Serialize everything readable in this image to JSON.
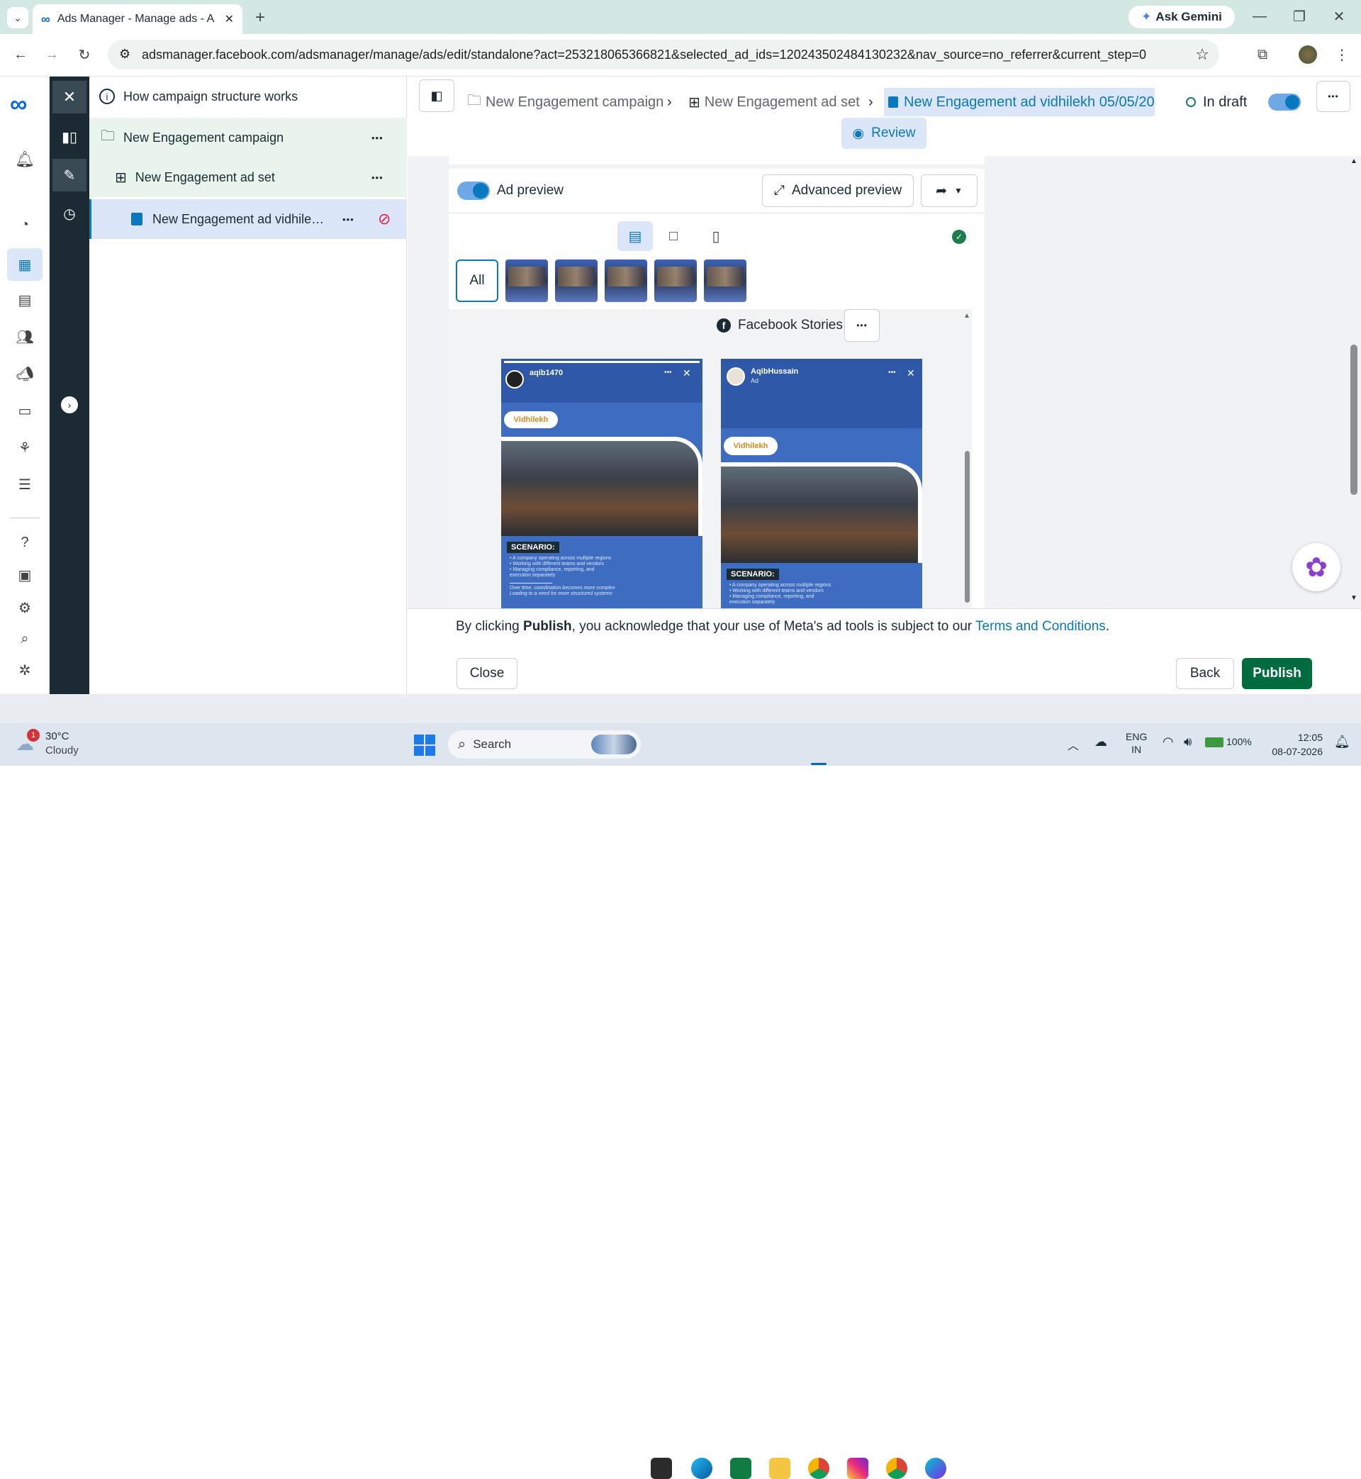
{
  "browser": {
    "tab_title": "Ads Manager - Manage ads - A",
    "new_tab": "+",
    "gemini": "Ask Gemini",
    "url": "adsmanager.facebook.com/adsmanager/manage/ads/edit/standalone?act=253218065366821&selected_ad_ids=120243502484130232&nav_source=no_referrer&current_step=0"
  },
  "tree": {
    "how_it_works": "How campaign structure works",
    "campaign": "New Engagement campaign",
    "adset": "New Engagement ad set",
    "ad": "New Engagement ad vidhile…",
    "more": "•••"
  },
  "breadcrumb": {
    "campaign": "New Engagement campaign",
    "adset": "New Engagement ad set",
    "ad": "New Engagement ad vidhilekh 05/05/20",
    "status": "In draft",
    "more": "•••"
  },
  "review_label": "Review",
  "preview": {
    "toggle_label": "Ad preview",
    "advanced": "Advanced preview",
    "all": "All",
    "placement": "Facebook Stories",
    "more": "•••",
    "stories": [
      {
        "user": "aqib1470",
        "sub": "",
        "logo": "Vidhilekh",
        "scenario": "SCENARIO:",
        "bullets": [
          "• A company operating across multiple regions",
          "• Working with different teams and vendors",
          "• Managing compliance, reporting, and",
          "  execution separately"
        ],
        "tail": "Over time, coordination becomes more complex",
        "tail2": "Leading to a need for more structured systems"
      },
      {
        "user": "AqibHussain",
        "sub": "Ad",
        "logo": "Vidhilekh",
        "scenario": "SCENARIO:",
        "bullets": [
          "• A company operating across multiple regions",
          "• Working with different teams and vendors",
          "• Managing compliance, reporting, and",
          "  execution separately"
        ],
        "tail": "",
        "tail2": ""
      }
    ]
  },
  "footer": {
    "text_pre": "By clicking ",
    "text_bold": "Publish",
    "text_mid": ", you acknowledge that your use of Meta's ad tools is subject to our ",
    "terms": "Terms and Conditions",
    "text_end": ".",
    "close": "Close",
    "back": "Back",
    "publish": "Publish"
  },
  "taskbar": {
    "weather_temp": "30°C",
    "weather_desc": "Cloudy",
    "weather_badge": "1",
    "search": "Search",
    "lang1": "ENG",
    "lang2": "IN",
    "battery": "100%",
    "time": "12:05",
    "date": "08-07-2026"
  },
  "colors": {
    "accent": "#0a78be",
    "publish": "#006b3e",
    "dark_rail": "#1c2b33"
  },
  "icons": [
    "meta-logo-icon",
    "bell-icon",
    "dashboard-icon",
    "table-icon",
    "pages-icon",
    "audience-icon",
    "campaign-icon",
    "billing-icon",
    "network-icon",
    "menu-icon",
    "help-icon",
    "news-icon",
    "settings-icon",
    "search-icon",
    "bug-icon"
  ]
}
